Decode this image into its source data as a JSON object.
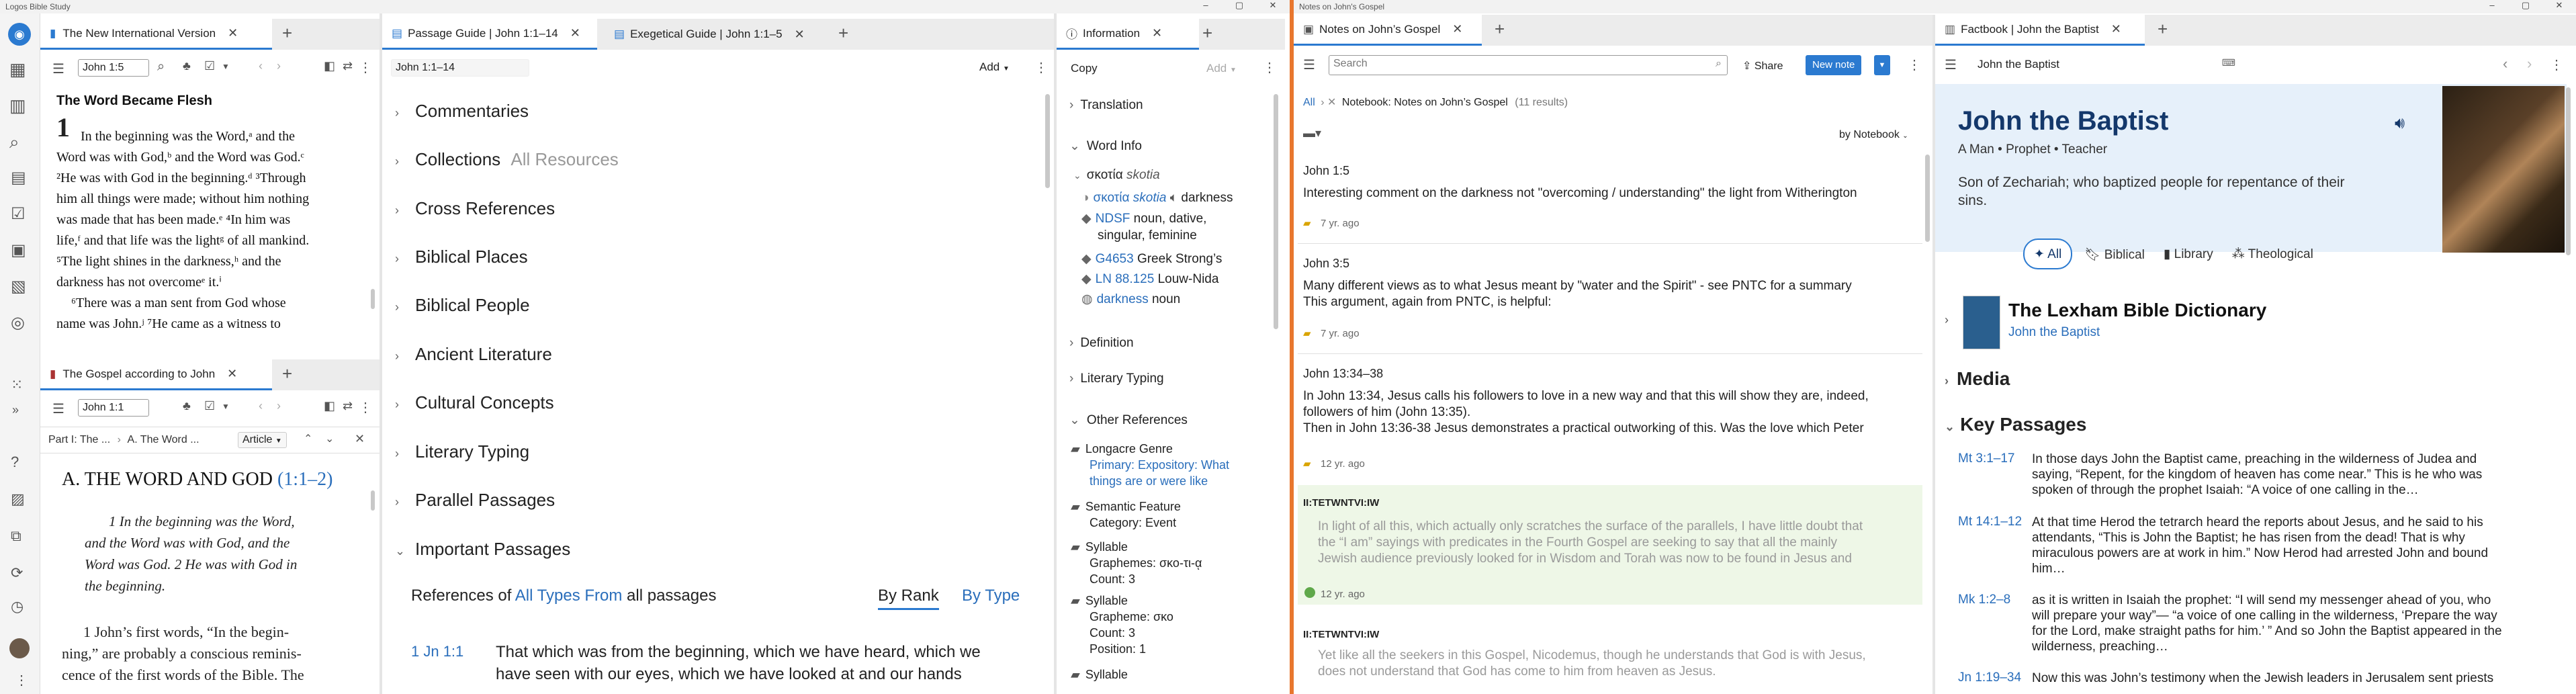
{
  "app": {
    "title": "Logos Bible Study",
    "notes_window_title": "Notes on John's Gospel"
  },
  "left_rail": {
    "items": [
      "logo",
      "home",
      "library",
      "search",
      "guides",
      "tools",
      "documents",
      "notebook",
      "atlas",
      "more-1",
      "more-2"
    ]
  },
  "pane1": {
    "tabs": [
      {
        "label": "The New International Version"
      }
    ],
    "ref_input": "John 1:5",
    "heading": "The Word Became Flesh",
    "chapter_num": "1",
    "lines": [
      "In the beginning was the Word,ᵃ and the",
      "Word was with God,ᵇ and the Word was God.ᶜ",
      "²He was with God in the beginning.ᵈ ³Through",
      "him all things were made; without him nothing",
      "was made that has been made.ᵉ ⁴In him was",
      "life,ᶠ and that life was the lightᵍ of all mankind.",
      "⁵The light shines in the darkness,ʰ and the",
      "darkness has not overcomeᵉ it.ⁱ",
      "⁶There was a man sent from God whose",
      "name was John.ʲ ⁷He came as a witness to"
    ]
  },
  "pane2": {
    "tabs": [
      {
        "label": "The Gospel according to John"
      }
    ],
    "ref_input": "John 1:1",
    "breadcrumb": [
      "Part I: The ...",
      "A. The Word ..."
    ],
    "article_label": "Article",
    "heading": "A. THE WORD AND GOD",
    "heading_ref": "(1:1–2)",
    "quote_lines": [
      "1 In the beginning was the Word,",
      "and the Word was with God, and the",
      "Word was God. 2 He was with God in",
      "the beginning."
    ],
    "comment_lines": [
      "1 John’s first words, “In the begin-",
      "ning,” are probably a conscious reminis-",
      "cence of the first words of the Bible. The"
    ]
  },
  "guide": {
    "tabs": [
      {
        "label": "Passage Guide | John 1:1–14"
      },
      {
        "label": "Exegetical Guide | John 1:1–5"
      }
    ],
    "ref_input": "John 1:1–14",
    "add_label": "Add",
    "sections": [
      {
        "label": "Commentaries",
        "extra": ""
      },
      {
        "label": "Collections",
        "extra": "All Resources"
      },
      {
        "label": "Cross References",
        "extra": ""
      },
      {
        "label": "Biblical Places",
        "extra": ""
      },
      {
        "label": "Biblical People",
        "extra": ""
      },
      {
        "label": "Ancient Literature",
        "extra": ""
      },
      {
        "label": "Cultural Concepts",
        "extra": ""
      },
      {
        "label": "Literary Typing",
        "extra": ""
      },
      {
        "label": "Parallel Passages",
        "extra": ""
      },
      {
        "label": "Important Passages",
        "extra": ""
      }
    ],
    "important": {
      "prefix": "References of",
      "link": "All Types From",
      "suffix": "all passages",
      "by_rank": "By Rank",
      "by_type": "By Type",
      "ref": "1 Jn 1:1",
      "text_lines": [
        "That which was from the beginning, which we have heard, which we",
        "have seen with our eyes, which we have looked at and our hands"
      ]
    }
  },
  "info": {
    "tab": "Information",
    "copy_label": "Copy",
    "add_label": "Add",
    "sections": {
      "translation": "Translation",
      "word_info": "Word Info",
      "definition": "Definition",
      "literary_typing": "Literary Typing",
      "other_refs": "Other References"
    },
    "lemma": "σκοτία",
    "lemma_translit": "skotia",
    "rows": [
      {
        "a": "σκοτία",
        "b": "skotia",
        "c": "darkness"
      },
      {
        "a": "NDSF",
        "b": "noun, dative,"
      },
      {
        "a": "",
        "b": "singular, feminine"
      },
      {
        "a": "G4653",
        "b": "Greek Strong’s"
      },
      {
        "a": "LN 88.125",
        "b": "Louw-Nida"
      },
      {
        "a": "darkness",
        "b": "noun"
      }
    ],
    "other": [
      {
        "title": "Longacre Genre",
        "lines": [
          "Primary: Expository: What",
          "things are or were like"
        ]
      },
      {
        "title": "Semantic Feature",
        "lines": [
          "Category: Event"
        ]
      },
      {
        "title": "Syllable",
        "lines": [
          "Graphemes: σκο-τι-ᾳ",
          "Count: 3"
        ]
      },
      {
        "title": "Syllable",
        "lines": [
          "Grapheme: σκο",
          "Count: 3",
          "Position: 1"
        ]
      },
      {
        "title": "Syllable",
        "lines": []
      }
    ]
  },
  "notes": {
    "tab": "Notes on John’s Gospel",
    "search_placeholder": "Search",
    "share_label": "Share",
    "new_note_label": "New note",
    "crumb_all": "All",
    "crumb_notebook": "Notebook: Notes on John’s Gospel",
    "crumb_count": "(11 results)",
    "sort_label": "by Notebook",
    "items": [
      {
        "ref": "John 1:5",
        "body": [
          "Interesting comment on the darkness not \"overcoming / understanding\" the light from Witherington"
        ],
        "age": "7 yr. ago",
        "faded": false
      },
      {
        "ref": "John 3:5",
        "body": [
          "Many different views as to what Jesus meant by \"water and the Spirit\" - see PNTC for a summary",
          "This argument, again from PNTC, is helpful:"
        ],
        "age": "7 yr. ago",
        "faded": false
      },
      {
        "ref": "John 13:34–38",
        "body": [
          "In John 13:34, Jesus calls his followers to love in a new way and that this will show they are, indeed,",
          "followers of him (John 13:35).",
          "Then in John 13:36-38 Jesus demonstrates a practical outworking of this. Was the love which Peter"
        ],
        "age": "12 yr. ago",
        "faded": false
      },
      {
        "ref": "II:TETWNTVI:IW",
        "body": [
          "In light of all this, which actually only scratches the surface of the parallels, I have little doubt that",
          "the “I am” sayings with predicates in the Fourth Gospel are seeking to say that all the mainly",
          "Jewish audience previously looked for in Wisdom and Torah was now to be found in Jesus and"
        ],
        "age": "12 yr. ago",
        "faded": true
      },
      {
        "ref": "II:TETWNTVI:IW",
        "body": [
          "Yet like all the seekers in this Gospel, Nicodemus, though he understands that God is with Jesus,",
          "does not understand that God has come to him from heaven as Jesus."
        ],
        "age": "",
        "faded": true
      }
    ]
  },
  "factbook": {
    "tab": "Factbook | John the Baptist",
    "search_value": "John the Baptist",
    "name": "John the Baptist",
    "tags": [
      "A Man",
      "Prophet",
      "Teacher"
    ],
    "description_lines": [
      "Son of Zechariah; who baptized people for repentance of their",
      "sins."
    ],
    "filters": [
      "All",
      "Biblical",
      "Library",
      "Theological"
    ],
    "dictionary_title": "The Lexham Bible Dictionary",
    "dictionary_sub": "John the Baptist",
    "media_label": "Media",
    "key_passages_label": "Key Passages",
    "passages": [
      {
        "ref": "Mt 3:1–17",
        "lines": [
          "In those days John the Baptist came, preaching in the wilderness of Judea and",
          "saying, “Repent, for the kingdom of heaven has come near.” This is he who was",
          "spoken of through the prophet Isaiah: “A voice of one calling in the…"
        ]
      },
      {
        "ref": "Mt 14:1–12",
        "lines": [
          "At that time Herod the tetrarch heard the reports about Jesus, and he said to his",
          "attendants, “This is John the Baptist; he has risen from the dead! That is why",
          "miraculous powers are at work in him.” Now Herod had arrested John and bound",
          "him…"
        ]
      },
      {
        "ref": "Mk 1:2–8",
        "lines": [
          "as it is written in Isaiah the prophet: “I will send my messenger ahead of you, who",
          "will prepare your way”— “a voice of one calling in the wilderness, ‘Prepare the way",
          "for the Lord, make straight paths for him.’ ” And so John the Baptist appeared in the",
          "wilderness, preaching…"
        ]
      },
      {
        "ref": "Jn 1:19–34",
        "lines": [
          "Now this was John’s testimony when the Jewish leaders in Jerusalem sent priests"
        ]
      }
    ]
  },
  "colors": {
    "accent": "#2b7ad0",
    "splitter": "#e8772e",
    "link": "#2a6ebb",
    "factbook_header": "#e6f0fa"
  }
}
